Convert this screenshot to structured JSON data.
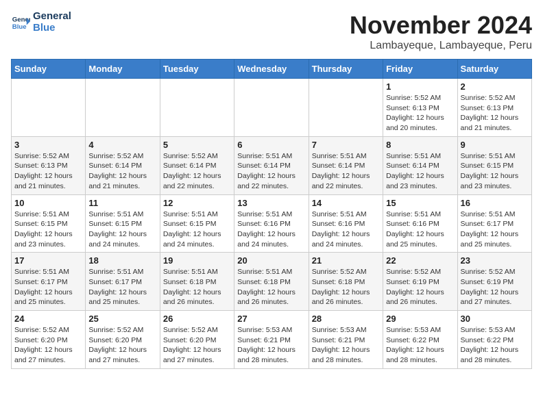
{
  "logo": {
    "line1": "General",
    "line2": "Blue"
  },
  "title": "November 2024",
  "subtitle": "Lambayeque, Lambayeque, Peru",
  "weekdays": [
    "Sunday",
    "Monday",
    "Tuesday",
    "Wednesday",
    "Thursday",
    "Friday",
    "Saturday"
  ],
  "weeks": [
    [
      {
        "day": "",
        "info": ""
      },
      {
        "day": "",
        "info": ""
      },
      {
        "day": "",
        "info": ""
      },
      {
        "day": "",
        "info": ""
      },
      {
        "day": "",
        "info": ""
      },
      {
        "day": "1",
        "info": "Sunrise: 5:52 AM\nSunset: 6:13 PM\nDaylight: 12 hours and 20 minutes."
      },
      {
        "day": "2",
        "info": "Sunrise: 5:52 AM\nSunset: 6:13 PM\nDaylight: 12 hours and 21 minutes."
      }
    ],
    [
      {
        "day": "3",
        "info": "Sunrise: 5:52 AM\nSunset: 6:13 PM\nDaylight: 12 hours and 21 minutes."
      },
      {
        "day": "4",
        "info": "Sunrise: 5:52 AM\nSunset: 6:14 PM\nDaylight: 12 hours and 21 minutes."
      },
      {
        "day": "5",
        "info": "Sunrise: 5:52 AM\nSunset: 6:14 PM\nDaylight: 12 hours and 22 minutes."
      },
      {
        "day": "6",
        "info": "Sunrise: 5:51 AM\nSunset: 6:14 PM\nDaylight: 12 hours and 22 minutes."
      },
      {
        "day": "7",
        "info": "Sunrise: 5:51 AM\nSunset: 6:14 PM\nDaylight: 12 hours and 22 minutes."
      },
      {
        "day": "8",
        "info": "Sunrise: 5:51 AM\nSunset: 6:14 PM\nDaylight: 12 hours and 23 minutes."
      },
      {
        "day": "9",
        "info": "Sunrise: 5:51 AM\nSunset: 6:15 PM\nDaylight: 12 hours and 23 minutes."
      }
    ],
    [
      {
        "day": "10",
        "info": "Sunrise: 5:51 AM\nSunset: 6:15 PM\nDaylight: 12 hours and 23 minutes."
      },
      {
        "day": "11",
        "info": "Sunrise: 5:51 AM\nSunset: 6:15 PM\nDaylight: 12 hours and 24 minutes."
      },
      {
        "day": "12",
        "info": "Sunrise: 5:51 AM\nSunset: 6:15 PM\nDaylight: 12 hours and 24 minutes."
      },
      {
        "day": "13",
        "info": "Sunrise: 5:51 AM\nSunset: 6:16 PM\nDaylight: 12 hours and 24 minutes."
      },
      {
        "day": "14",
        "info": "Sunrise: 5:51 AM\nSunset: 6:16 PM\nDaylight: 12 hours and 24 minutes."
      },
      {
        "day": "15",
        "info": "Sunrise: 5:51 AM\nSunset: 6:16 PM\nDaylight: 12 hours and 25 minutes."
      },
      {
        "day": "16",
        "info": "Sunrise: 5:51 AM\nSunset: 6:17 PM\nDaylight: 12 hours and 25 minutes."
      }
    ],
    [
      {
        "day": "17",
        "info": "Sunrise: 5:51 AM\nSunset: 6:17 PM\nDaylight: 12 hours and 25 minutes."
      },
      {
        "day": "18",
        "info": "Sunrise: 5:51 AM\nSunset: 6:17 PM\nDaylight: 12 hours and 25 minutes."
      },
      {
        "day": "19",
        "info": "Sunrise: 5:51 AM\nSunset: 6:18 PM\nDaylight: 12 hours and 26 minutes."
      },
      {
        "day": "20",
        "info": "Sunrise: 5:51 AM\nSunset: 6:18 PM\nDaylight: 12 hours and 26 minutes."
      },
      {
        "day": "21",
        "info": "Sunrise: 5:52 AM\nSunset: 6:18 PM\nDaylight: 12 hours and 26 minutes."
      },
      {
        "day": "22",
        "info": "Sunrise: 5:52 AM\nSunset: 6:19 PM\nDaylight: 12 hours and 26 minutes."
      },
      {
        "day": "23",
        "info": "Sunrise: 5:52 AM\nSunset: 6:19 PM\nDaylight: 12 hours and 27 minutes."
      }
    ],
    [
      {
        "day": "24",
        "info": "Sunrise: 5:52 AM\nSunset: 6:20 PM\nDaylight: 12 hours and 27 minutes."
      },
      {
        "day": "25",
        "info": "Sunrise: 5:52 AM\nSunset: 6:20 PM\nDaylight: 12 hours and 27 minutes."
      },
      {
        "day": "26",
        "info": "Sunrise: 5:52 AM\nSunset: 6:20 PM\nDaylight: 12 hours and 27 minutes."
      },
      {
        "day": "27",
        "info": "Sunrise: 5:53 AM\nSunset: 6:21 PM\nDaylight: 12 hours and 28 minutes."
      },
      {
        "day": "28",
        "info": "Sunrise: 5:53 AM\nSunset: 6:21 PM\nDaylight: 12 hours and 28 minutes."
      },
      {
        "day": "29",
        "info": "Sunrise: 5:53 AM\nSunset: 6:22 PM\nDaylight: 12 hours and 28 minutes."
      },
      {
        "day": "30",
        "info": "Sunrise: 5:53 AM\nSunset: 6:22 PM\nDaylight: 12 hours and 28 minutes."
      }
    ]
  ]
}
